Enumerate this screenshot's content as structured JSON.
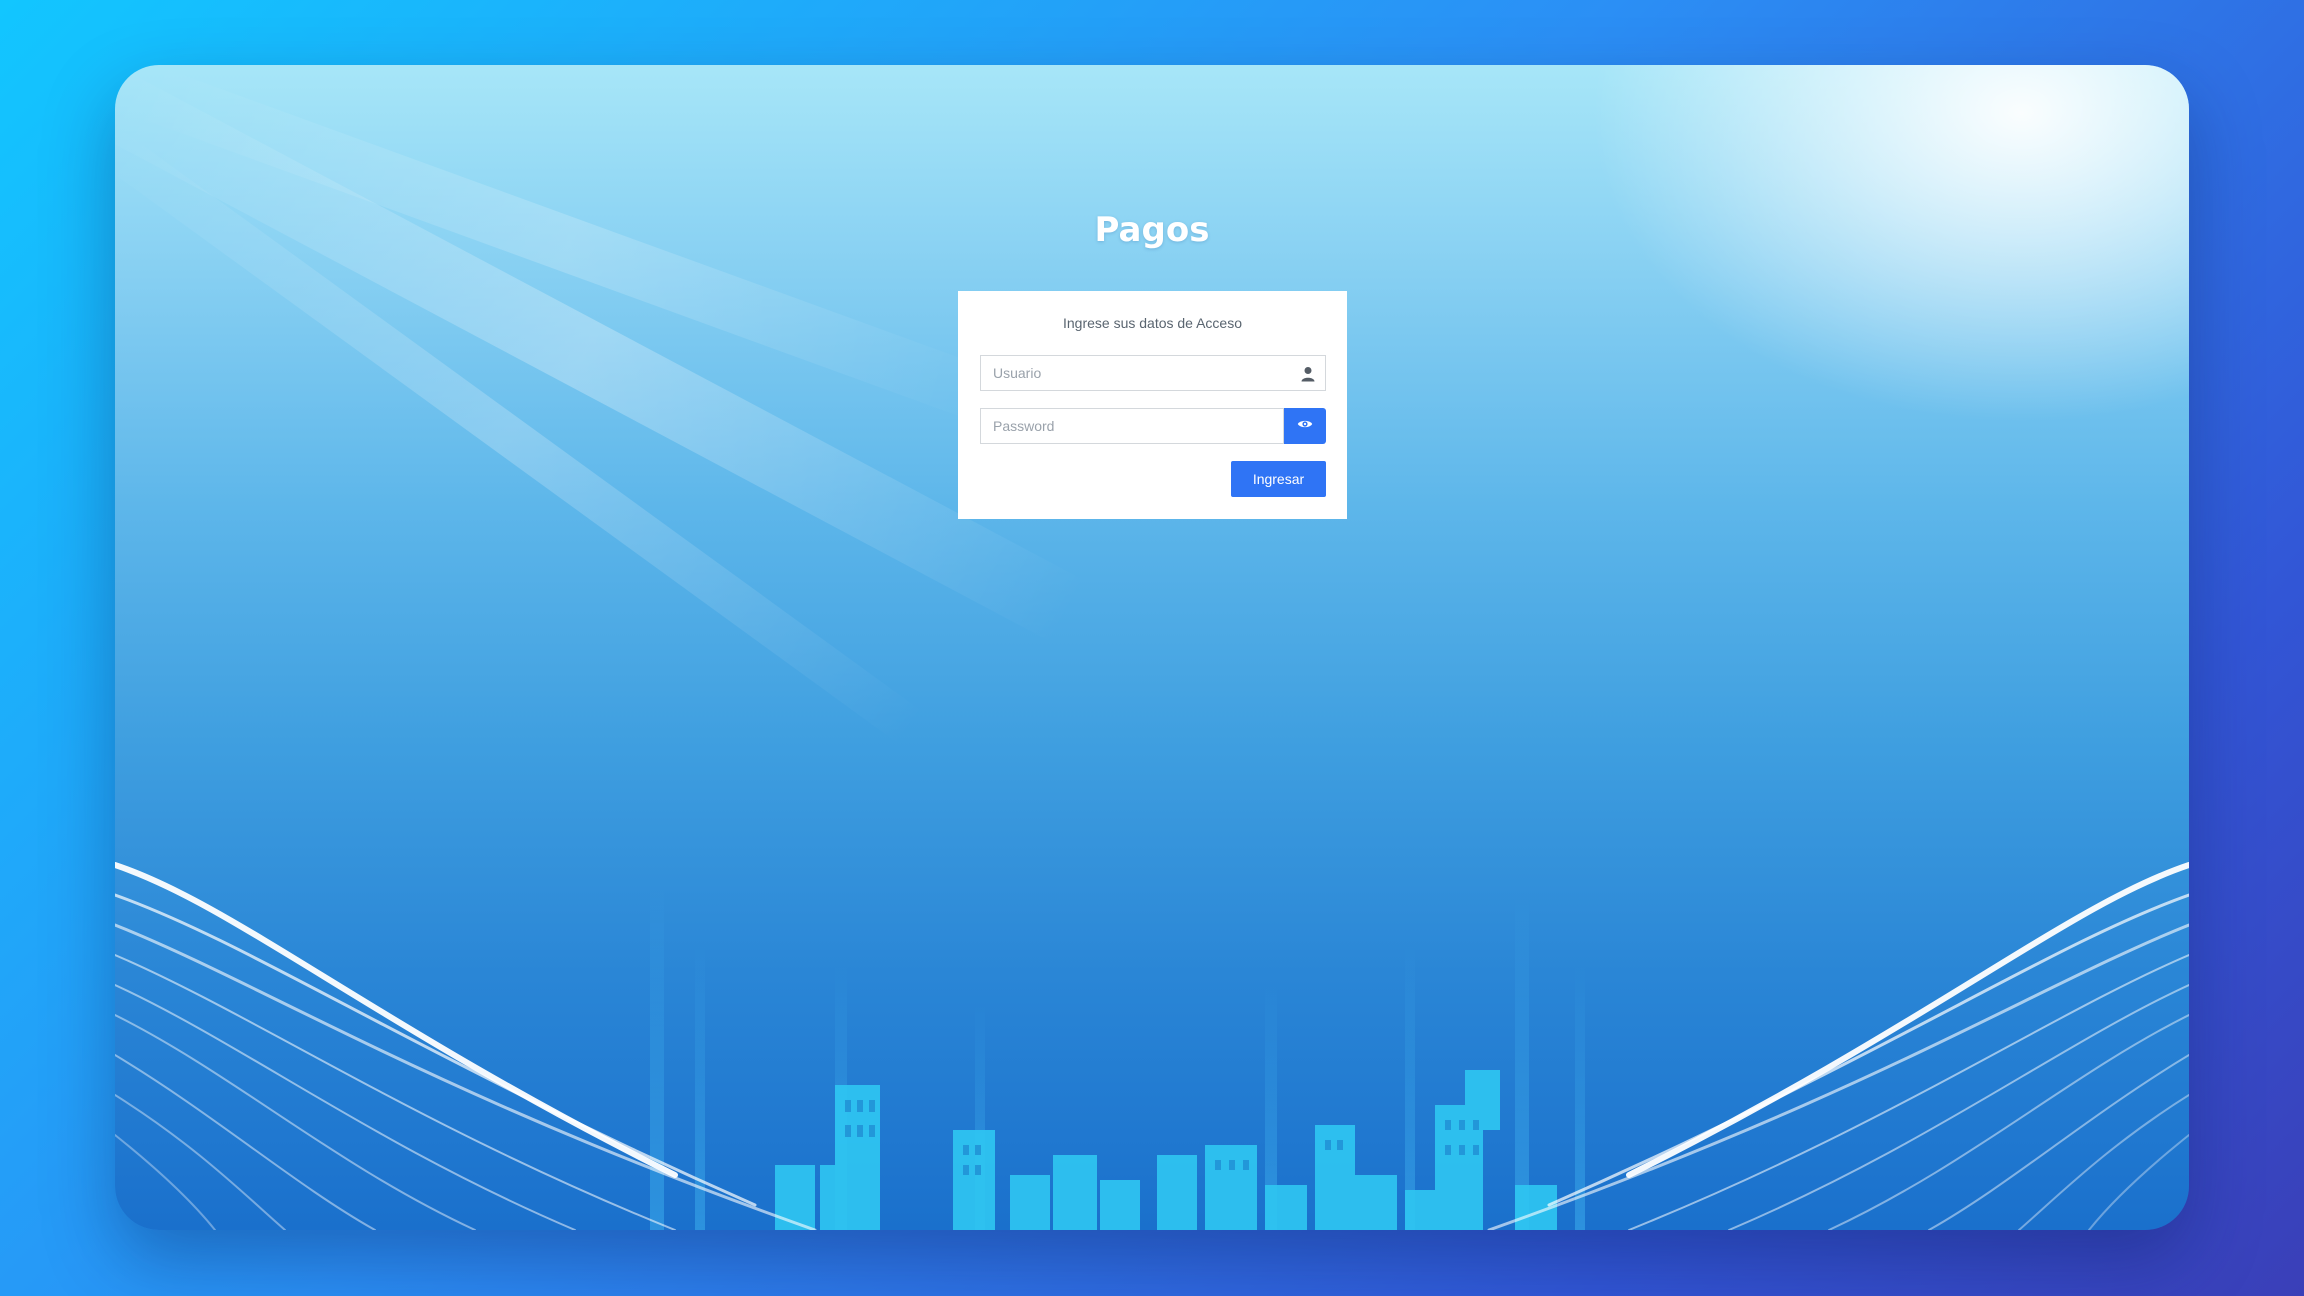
{
  "app": {
    "title": "Pagos"
  },
  "login": {
    "message": "Ingrese sus datos de Acceso",
    "username": {
      "value": "",
      "placeholder": "Usuario",
      "icon": "user-icon"
    },
    "password": {
      "value": "",
      "placeholder": "Password",
      "toggle_icon": "eye-icon"
    },
    "submit_label": "Ingresar"
  },
  "colors": {
    "accent": "#2f74f5",
    "card": "#ffffff",
    "background_top": "#a7e6f8",
    "background_bottom": "#1a70cc"
  }
}
